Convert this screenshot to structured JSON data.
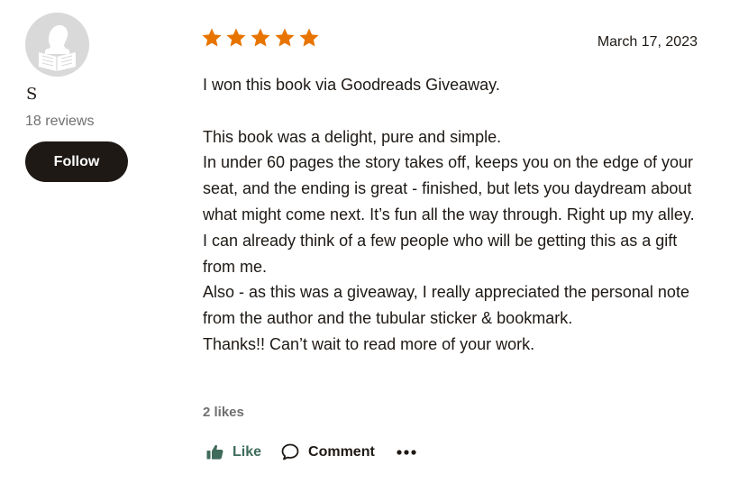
{
  "reviewer": {
    "name": "S",
    "review_count": "18 reviews",
    "follow_label": "Follow"
  },
  "review": {
    "rating": 5,
    "rating_max": 5,
    "star_color": "#e87400",
    "date": "March 17, 2023",
    "paragraphs": [
      "I won this book via Goodreads Giveaway.",
      "",
      "This book was a delight, pure and simple.",
      "In under 60 pages the story takes off, keeps you on the edge of your seat, and the ending is great - finished, but lets you daydream about what might come next. It’s fun all the way through. Right up my alley.",
      "I can already think of a few people who will be getting this as a gift from me.",
      "Also - as this was a giveaway, I really appreciated the personal note from the author and the tubular sticker & bookmark.",
      "Thanks!! Can’t wait to read more of your work."
    ],
    "likes": "2 likes"
  },
  "actions": {
    "like_label": "Like",
    "comment_label": "Comment",
    "like_icon": "thumbs-up-icon",
    "comment_icon": "speech-bubble-icon",
    "more_icon": "more-dots-icon",
    "like_color": "#3f6b5a"
  }
}
